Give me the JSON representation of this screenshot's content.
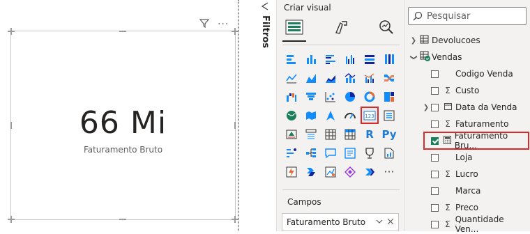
{
  "card": {
    "value": "66 Mi",
    "label": "Faturamento Bruto"
  },
  "filters": {
    "label": "Filtros"
  },
  "viz": {
    "header": "Criar visual",
    "tabs": [
      "build-visual-icon",
      "format-visual-icon",
      "analytics-icon"
    ],
    "icons": [
      "stacked-bar-icon",
      "stacked-column-icon",
      "clustered-bar-icon",
      "clustered-column-icon",
      "100-bar-icon",
      "100-column-icon",
      "line-chart-icon",
      "area-chart-icon",
      "stacked-area-icon",
      "line-column-icon",
      "line-clustered-icon",
      "ribbon-chart-icon",
      "waterfall-icon",
      "funnel-icon",
      "scatter-icon",
      "pie-icon",
      "donut-icon",
      "treemap-icon",
      "map-icon",
      "filled-map-icon",
      "azure-map-icon",
      "gauge-icon",
      "card-icon",
      "multi-row-card-icon",
      "kpi-icon",
      "slicer-icon",
      "table-icon",
      "matrix-icon",
      "r-visual-icon",
      "python-visual-icon",
      "key-influencers-icon",
      "decomposition-tree-icon",
      "qa-icon",
      "narrative-icon",
      "paginated-icon",
      "scorecard-icon",
      "power-apps-icon",
      "power-automate-icon",
      "arcgis-icon",
      "diamond-icon",
      "chevron-visual-icon",
      "more-visuals-icon"
    ],
    "glyphs": {
      "r": "R",
      "py": "Py",
      "more": "···"
    },
    "campos_label": "Campos",
    "campos_value": "Faturamento Bruto"
  },
  "data": {
    "search_placeholder": "Pesquisar",
    "tree": [
      {
        "kind": "table",
        "expand": ">",
        "label": "Devolucoes"
      },
      {
        "kind": "table",
        "expand": "v",
        "label": "Vendas"
      },
      {
        "kind": "field",
        "label": "Codigo Venda",
        "icon": "",
        "checked": false
      },
      {
        "kind": "field",
        "label": "Custo",
        "icon": "Σ",
        "checked": false
      },
      {
        "kind": "field",
        "label": "Data da Venda",
        "icon": "calendar",
        "checked": false,
        "expand": ">"
      },
      {
        "kind": "field",
        "label": "Faturamento",
        "icon": "Σ",
        "checked": false
      },
      {
        "kind": "field",
        "label": "Faturamento Bru...",
        "icon": "calc",
        "checked": true
      },
      {
        "kind": "field",
        "label": "Loja",
        "icon": "",
        "checked": false
      },
      {
        "kind": "field",
        "label": "Lucro",
        "icon": "Σ",
        "checked": false
      },
      {
        "kind": "field",
        "label": "Marca",
        "icon": "",
        "checked": false
      },
      {
        "kind": "field",
        "label": "Preco",
        "icon": "Σ",
        "checked": false
      },
      {
        "kind": "field",
        "label": "Quantidade Ven...",
        "icon": "Σ",
        "checked": false
      }
    ]
  }
}
